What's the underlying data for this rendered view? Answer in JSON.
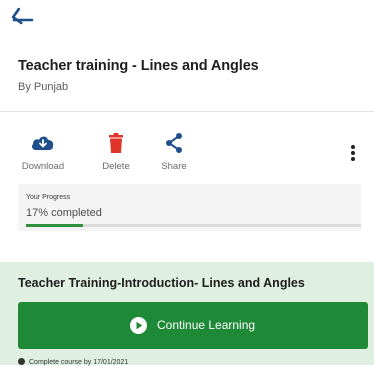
{
  "nav": {
    "back_icon": "back-arrow-icon"
  },
  "course": {
    "title": "Teacher training - Lines and Angles",
    "author": "By Punjab"
  },
  "actions": {
    "download_label": "Download",
    "delete_label": "Delete",
    "share_label": "Share"
  },
  "progress": {
    "label": "Your Progress",
    "value_text": "17% completed",
    "fraction": 0.17
  },
  "lesson": {
    "title": "Teacher Training-Introduction- Lines and Angles",
    "button_label": "Continue Learning",
    "complete_by": "Complete course by 17/01/2021"
  },
  "colors": {
    "accent": "#1e8a38",
    "lesson_bg": "#dff0e3",
    "download_icon": "#1f4f8a",
    "delete_icon": "#e0342b",
    "share_icon": "#1f4f8a"
  }
}
